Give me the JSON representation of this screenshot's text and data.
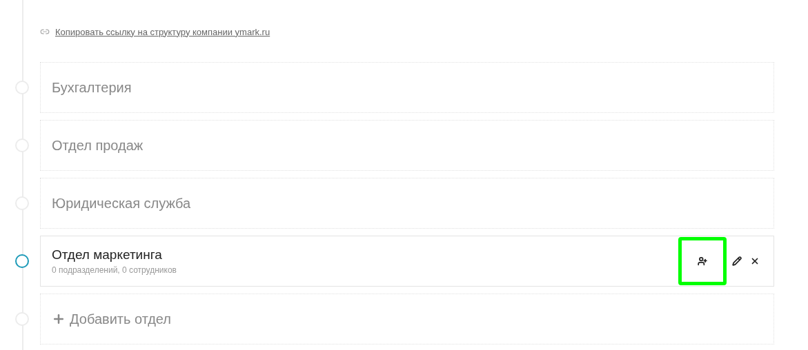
{
  "copy_link": {
    "text": "Копировать ссылку на структуру компании ymark.ru"
  },
  "departments": [
    {
      "name": "Бухгалтерия",
      "selected": false
    },
    {
      "name": "Отдел продаж",
      "selected": false
    },
    {
      "name": "Юридическая служба",
      "selected": false
    },
    {
      "name": "Отдел маркетинга",
      "subtitle": "0 подразделений, 0 сотрудников",
      "selected": true,
      "actions": [
        {
          "kind": "add-employee",
          "highlighted": true
        },
        {
          "kind": "edit",
          "highlighted": false
        },
        {
          "kind": "delete",
          "highlighted": false
        }
      ]
    }
  ],
  "add_department": {
    "label": "Добавить отдел"
  }
}
